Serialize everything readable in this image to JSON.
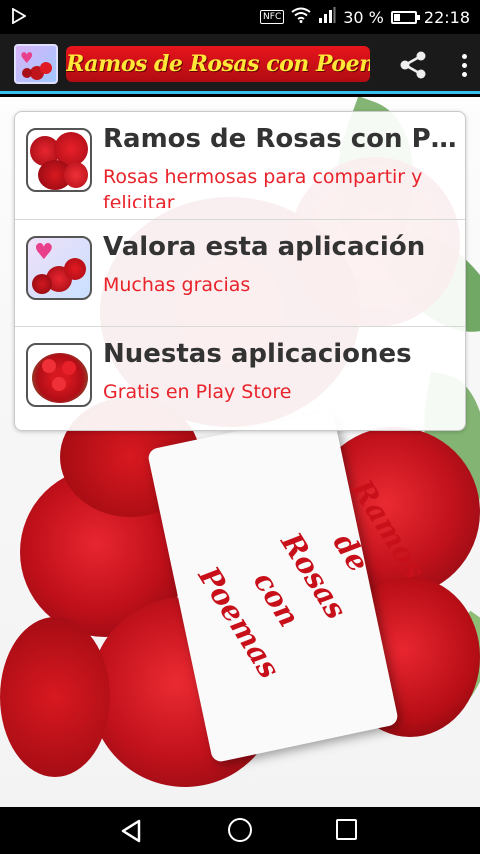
{
  "status_bar": {
    "notification_icon": "play-icon",
    "nfc_label": "NFC",
    "battery_text": "30 %",
    "time": "22:18"
  },
  "app_bar": {
    "title": "Ramos de Rosas con Poemas",
    "share_icon": "share-icon",
    "overflow_icon": "more-vert-icon"
  },
  "menu": {
    "items": [
      {
        "title": "Ramos de Rosas con Poemas",
        "subtitle": "Rosas hermosas para compartir y felicitar",
        "icon": "rose-bouquet-thumb"
      },
      {
        "title": "Valora esta aplicación",
        "subtitle": "Muchas gracias",
        "icon": "rose-heart-thumb"
      },
      {
        "title": "Nuestas aplicaciones",
        "subtitle": "Gratis en Play Store",
        "icon": "rose-basket-thumb"
      }
    ]
  },
  "background_card": {
    "lines": [
      "Ramos de",
      "Rosas con",
      "Poemas"
    ]
  },
  "nav_bar": {
    "back_icon": "back-icon",
    "home_icon": "home-icon",
    "recents_icon": "recents-icon"
  },
  "colors": {
    "accent": "#35c0f0",
    "title_red": "#e8232b",
    "title_yellow": "#ffe838"
  }
}
